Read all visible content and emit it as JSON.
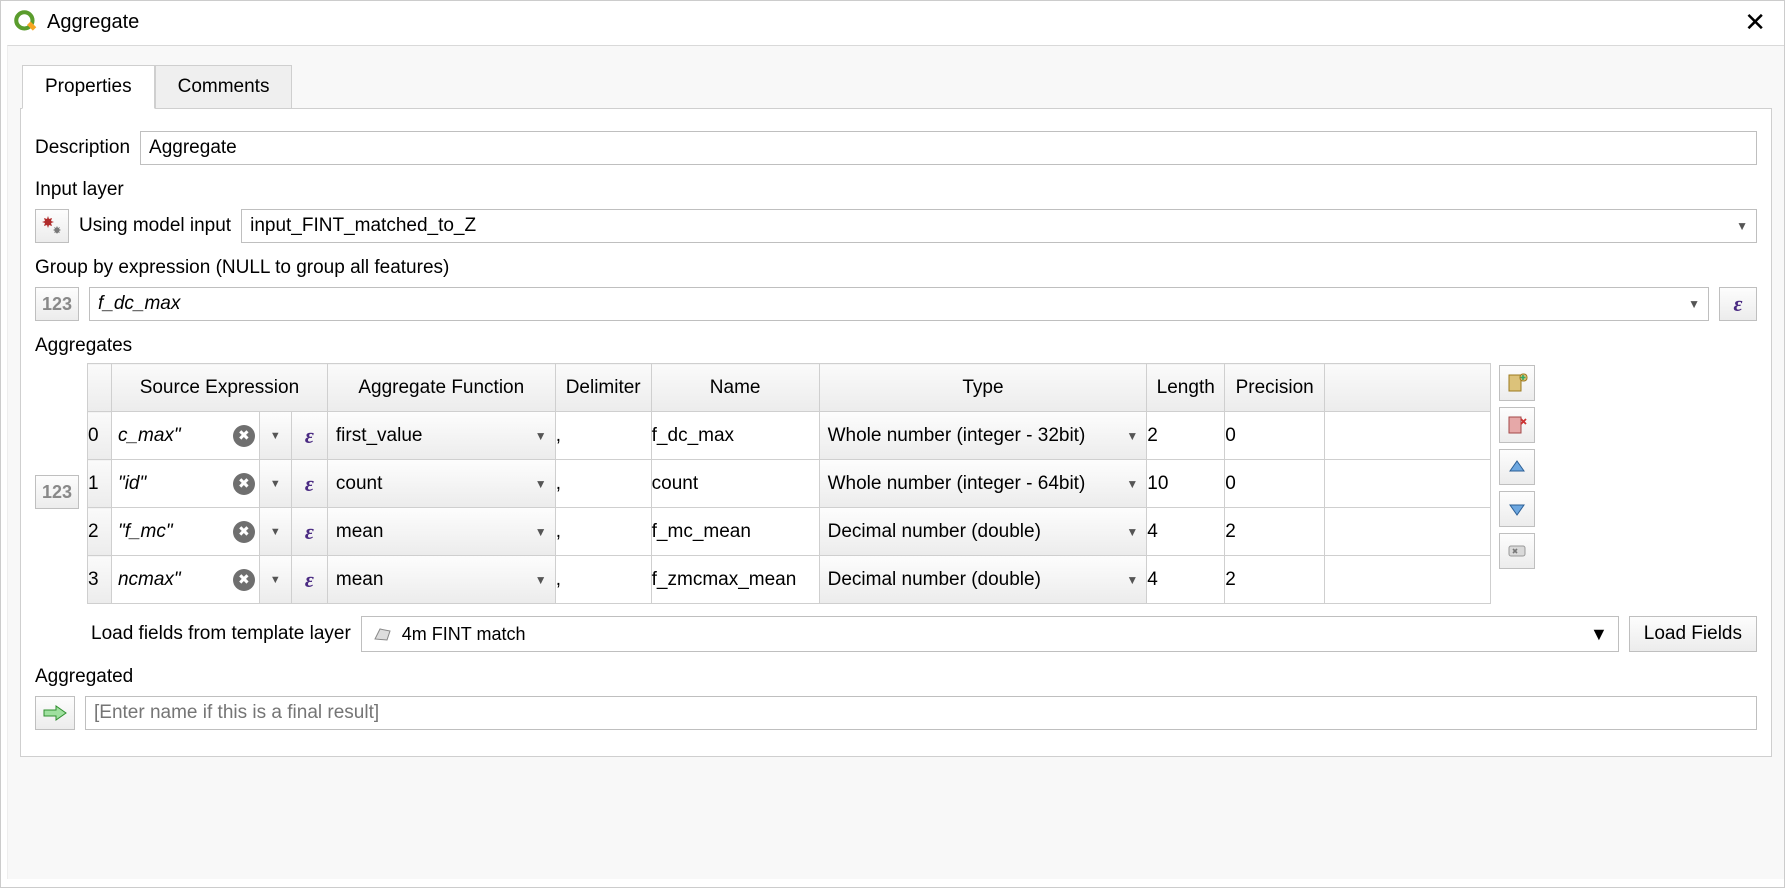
{
  "title": "Aggregate",
  "tabs": {
    "properties": "Properties",
    "comments": "Comments"
  },
  "description": {
    "label": "Description",
    "value": "Aggregate"
  },
  "input_layer": {
    "label": "Input layer",
    "mode": "Using model input",
    "value": "input_FINT_matched_to_Z"
  },
  "group_by": {
    "label": "Group by expression (NULL to group all features)",
    "value": "f_dc_max",
    "num_label": "123",
    "epsilon": "ε"
  },
  "aggregates": {
    "label": "Aggregates",
    "headers": {
      "source": "Source Expression",
      "func": "Aggregate Function",
      "delim": "Delimiter",
      "name": "Name",
      "type": "Type",
      "length": "Length",
      "precision": "Precision"
    },
    "rows": [
      {
        "idx": "0",
        "source": "c_max\"",
        "func": "first_value",
        "delim": ",",
        "name": "f_dc_max",
        "type": "Whole number (integer - 32bit)",
        "length": "2",
        "precision": "0"
      },
      {
        "idx": "1",
        "source": "\"id\"",
        "func": "count",
        "delim": ",",
        "name": "count",
        "type": "Whole number (integer - 64bit)",
        "length": "10",
        "precision": "0"
      },
      {
        "idx": "2",
        "source": "\"f_mc\"",
        "func": "mean",
        "delim": ",",
        "name": "f_mc_mean",
        "type": "Decimal number (double)",
        "length": "4",
        "precision": "2"
      },
      {
        "idx": "3",
        "source": "ncmax\"",
        "func": "mean",
        "delim": ",",
        "name": "f_zmcmax_mean",
        "type": "Decimal number (double)",
        "length": "4",
        "precision": "2"
      }
    ],
    "sidebar_num": "123"
  },
  "load_from": {
    "label": "Load fields from template layer",
    "value": "4m FINT match",
    "button": "Load Fields"
  },
  "output": {
    "label": "Aggregated",
    "placeholder": "[Enter name if this is a final result]"
  },
  "glyphs": {
    "caret": "▼",
    "clear": "✖",
    "epsilon": "ε"
  }
}
